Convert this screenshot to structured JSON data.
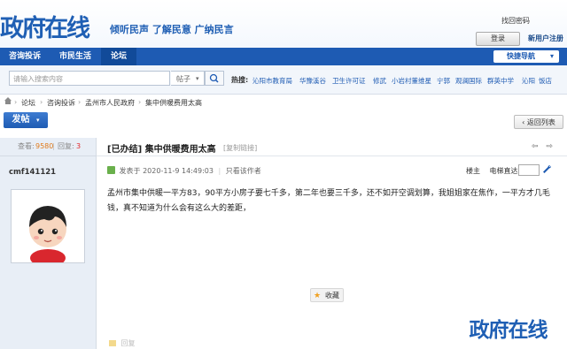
{
  "header": {
    "logo_text": "政府在线",
    "slogan": "倾听民声 了解民意 广纳民言",
    "retrieve_password": "找回密码",
    "login_button": "登录",
    "register_link": "新用户注册"
  },
  "nav": {
    "items": [
      "咨询投诉",
      "市民生活",
      "论坛"
    ],
    "quick_nav": "快捷导航"
  },
  "search": {
    "placeholder": "请输入搜索内容",
    "type": "帖子",
    "hot_label": "热搜:",
    "hot_items": [
      "沁阳市教育局",
      "华豫溪谷",
      "卫生许可证",
      "修武",
      "小岩村董维星",
      "宁郭",
      "观澜国际",
      "群英中学",
      "沁阳",
      "饭店"
    ]
  },
  "breadcrumb": [
    "论坛",
    "咨询投诉",
    "孟州市人民政府",
    "集中供暖费用太高"
  ],
  "actions": {
    "new_post": "发帖",
    "back_to_list": "返回列表"
  },
  "thread": {
    "views_label": "查看:",
    "views": "9580",
    "replies_label": "回复:",
    "replies": "3",
    "title": "[已办结] 集中供暖费用太高",
    "copy_link": "[复制链接]",
    "author": "cmf141121",
    "posted_at": "发表于 2020-11-9 14:49:03",
    "author_only": "只看该作者",
    "floor_label": "楼主",
    "jump_label": "电梯直达",
    "content": "孟州市集中供暖一平方83，90平方小房子要七千多，第二年也要三千多，还不如开空调划算，我姐姐家在焦作，一平方才几毛钱，真不知道为什么会有这么大的差距，",
    "favorite": "收藏",
    "reply_label": "回复"
  },
  "watermark": "政府在线",
  "colors": {
    "brand_blue": "#1e5bb3",
    "stats_red": "#e0272b",
    "views_orange": "#e07a1b"
  }
}
